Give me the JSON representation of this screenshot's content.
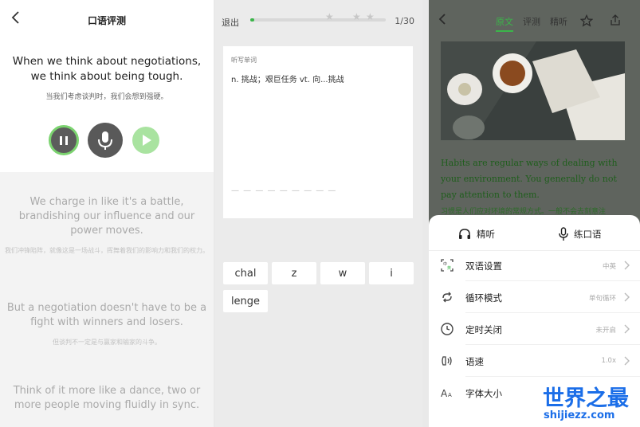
{
  "panel1": {
    "title": "口语评测",
    "current_sentence": {
      "en": "When we think about negotiations, we think about being tough.",
      "cn": "当我们考虑谈判时，我们会想到强硬。"
    },
    "sentences": [
      {
        "en": "We charge in like it's a battle, brandishing our influence and our power moves.",
        "cn": "我们冲锋陷阵，就像这是一场战斗，挥舞着我们的影响力和我们的权力。"
      },
      {
        "en": "But a negotiation doesn't have to be a fight with winners and losers.",
        "cn": "但谈判不一定是与赢家和输家的斗争。"
      },
      {
        "en": "Think of it more like a dance, two or more people moving fluidly in sync.",
        "cn": ""
      }
    ]
  },
  "panel2": {
    "exit_label": "退出",
    "progress_count": "1/30",
    "progress_fraction": 0.03,
    "stars_filled": 0,
    "stars_total": 3,
    "card_label": "听写单词",
    "definition": "n. 挑战；艰巨任务 vt. 向...挑战",
    "blank_line": "— — — — — — — — —",
    "keys": [
      "chal",
      "z",
      "w",
      "i",
      "lenge"
    ]
  },
  "panel3": {
    "tabs": [
      "原文",
      "评测",
      "精听"
    ],
    "active_tab": "原文",
    "accent_color": "#3bb54a",
    "article_en": "Habits are regular ways of dealing with your environment. You generally do not pay attention to them.",
    "article_cn": "习惯是人们应对环境的常规方式。一般不会去刻意注",
    "modes": [
      "精听",
      "练口语"
    ],
    "settings": [
      {
        "label": "双语设置",
        "value": "中英",
        "icon": "bilingual-icon"
      },
      {
        "label": "循环模式",
        "value": "单句循环",
        "icon": "loop-icon"
      },
      {
        "label": "定时关闭",
        "value": "未开启",
        "icon": "clock-icon"
      },
      {
        "label": "语速",
        "value": "1.0x",
        "icon": "speed-icon"
      },
      {
        "label": "字体大小",
        "value": "",
        "icon": "font-size-icon"
      }
    ]
  },
  "watermark": {
    "cn": "世界之最",
    "en": "shijiezz.com"
  }
}
